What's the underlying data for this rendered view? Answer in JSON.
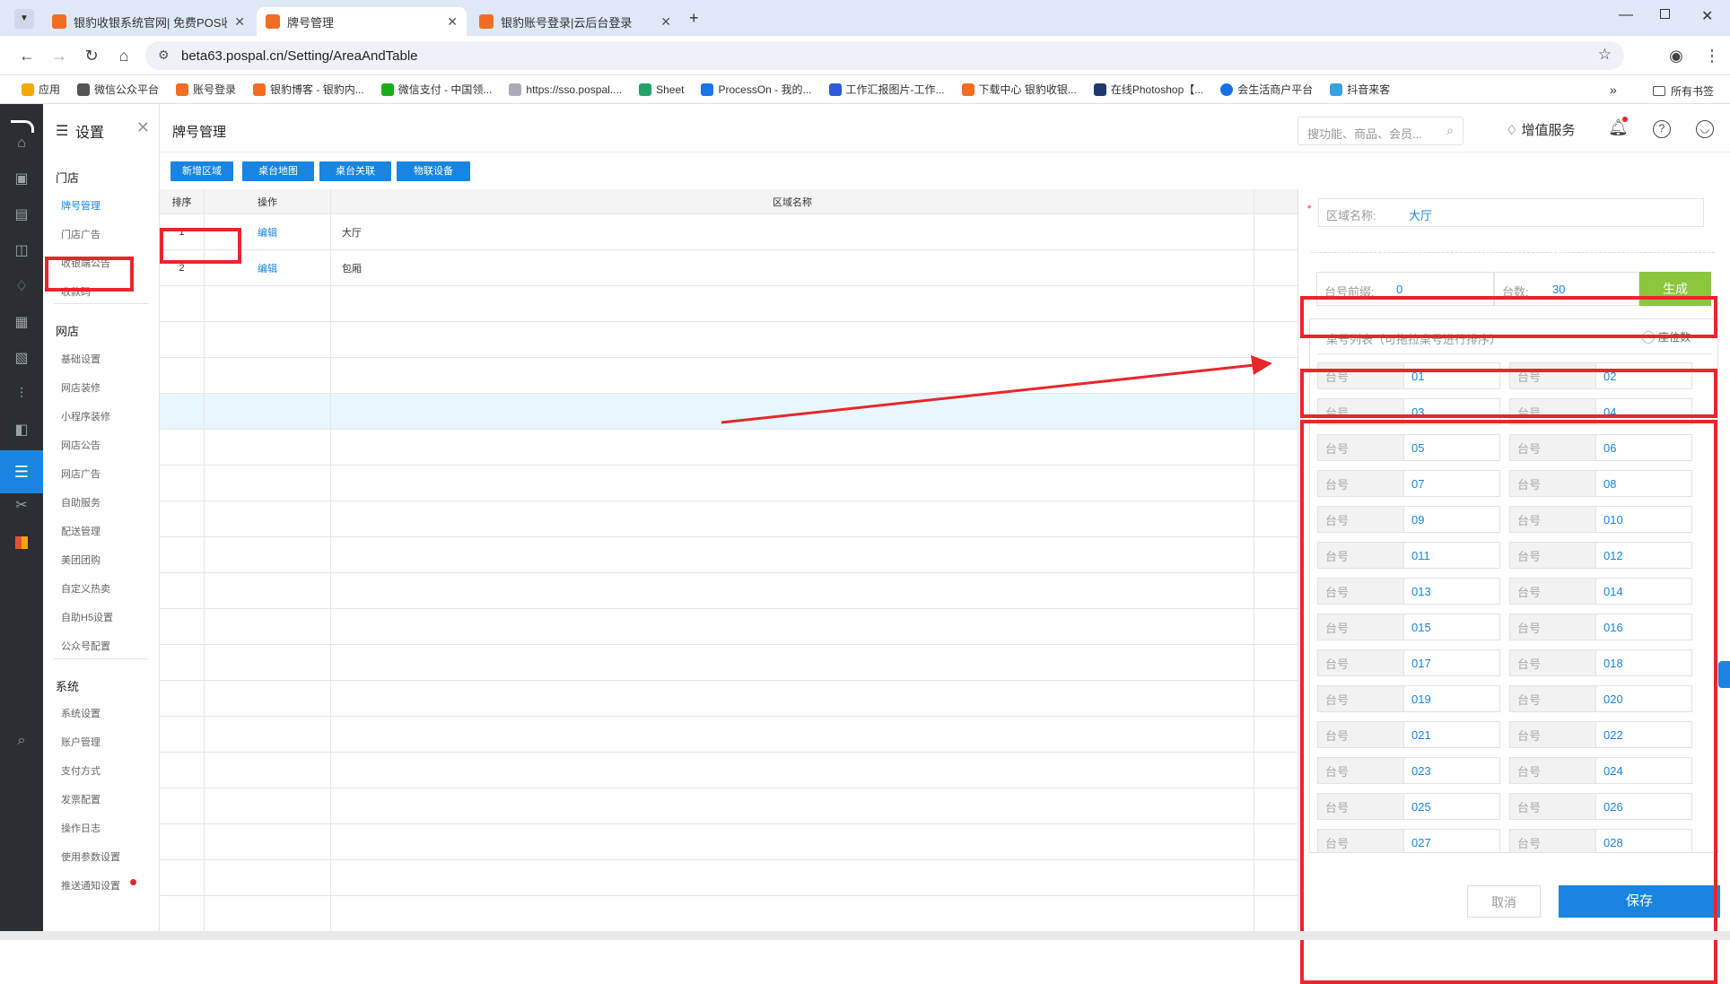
{
  "browser": {
    "tabs": [
      {
        "title": "银豹收银系统官网| 免费POS收银"
      },
      {
        "title": "牌号管理"
      },
      {
        "title": "银豹账号登录|云后台登录"
      }
    ],
    "url": "beta63.pospal.cn/Setting/AreaAndTable",
    "bookmarks": [
      "应用",
      "微信公众平台",
      "账号登录",
      "银豹博客 - 银豹内...",
      "微信支付 - 中国领...",
      "https://sso.pospal....",
      "Sheet",
      "ProcessOn - 我的...",
      "工作汇报图片-工作...",
      "下载中心 银豹收银...",
      "在线Photoshop【...",
      "会生活商户平台",
      "抖音来客"
    ],
    "all_bookmarks": "所有书签",
    "colors": {
      "tabbar": "#dfe8f7"
    }
  },
  "app": {
    "accent": "#1985e0",
    "highlight": "#e8262c",
    "submenu": {
      "title": "设置",
      "sections": [
        {
          "name": "门店",
          "items": [
            "牌号管理",
            "门店广告",
            "收银端公告",
            "收款码"
          ]
        },
        {
          "name": "网店",
          "items": [
            "基础设置",
            "网店装修",
            "小程序装修",
            "网店公告",
            "网店广告",
            "自助服务",
            "配送管理",
            "美团团购",
            "自定义热卖",
            "自助H5设置",
            "公众号配置"
          ]
        },
        {
          "name": "系统",
          "items": [
            "系统设置",
            "账户管理",
            "支付方式",
            "发票配置",
            "操作日志",
            "使用参数设置",
            "推送通知设置"
          ]
        }
      ]
    },
    "header": {
      "title": "牌号管理",
      "search_placeholder": "搜功能、商品、会员...",
      "value_service": "增值服务"
    },
    "toolbar": [
      "新增区域",
      "桌台地图",
      "桌台关联",
      "物联设备"
    ],
    "table": {
      "headers": [
        "排序",
        "操作",
        "区域名称"
      ],
      "rows": [
        {
          "order": "1",
          "action": "编辑",
          "name": "大厅"
        },
        {
          "order": "2",
          "action": "编辑",
          "name": "包厢"
        }
      ]
    },
    "panel": {
      "area_label": "区域名称:",
      "area_value": "大厅",
      "prefix_label": "台号前缀:",
      "prefix_value": "0",
      "count_label": "台数:",
      "count_value": "30",
      "generate": "生成",
      "list_title": "桌号列表（可拖拉桌号进行排序）",
      "seat_toggle": "座位数",
      "tag_label": "台号",
      "tables": [
        "01",
        "02",
        "03",
        "04",
        "05",
        "06",
        "07",
        "08",
        "09",
        "010",
        "011",
        "012",
        "013",
        "014",
        "015",
        "016",
        "017",
        "018",
        "019",
        "020",
        "021",
        "022",
        "023",
        "024",
        "025",
        "026",
        "027",
        "028"
      ],
      "cancel": "取消",
      "save": "保存"
    }
  }
}
